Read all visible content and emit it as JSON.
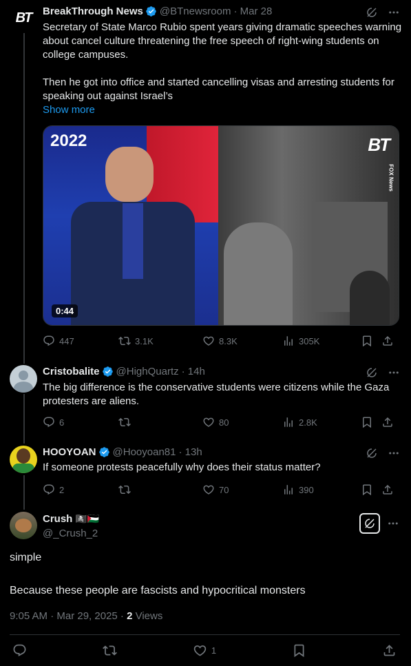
{
  "posts": [
    {
      "name": "BreakThrough News",
      "handle": "@BTnewsroom",
      "time": "· Mar 28",
      "text1": "Secretary of State Marco Rubio spent years giving dramatic speeches warning about cancel culture threatening the free speech of right-wing students on college campuses.",
      "text2": "Then he got into office and started cancelling visas and arresting students for speaking out against Israel’s",
      "show_more": "Show more",
      "media": {
        "year": "2022",
        "duration": "0:44",
        "logo": "BT",
        "watermark": "FOX News"
      },
      "replies": "447",
      "reposts": "3.1K",
      "likes": "8.3K",
      "views": "305K"
    },
    {
      "name": "Cristobalite",
      "handle": "@HighQuartz",
      "time": "· 14h",
      "text": "The big difference is the conservative students were citizens while the Gaza protesters are aliens.",
      "replies": "6",
      "reposts": "",
      "likes": "80",
      "views": "2.8K"
    },
    {
      "name": "HOOYOAN",
      "handle": "@Hooyoan81",
      "time": "· 13h",
      "text": "If someone protests peacefully why does their status matter?",
      "replies": "2",
      "reposts": "",
      "likes": "70",
      "views": "390"
    }
  ],
  "main": {
    "name": "Crush",
    "emoji": "🏴‍☠️🇵🇸",
    "handle": "@_Crush_2",
    "line1": "simple",
    "line2": "Because these  people are fascists and hypocritical monsters",
    "time": "9:05 AM · Mar 29, 2025 · ",
    "views_count": "2",
    "views_label": " Views",
    "likes": "1"
  },
  "colors": {
    "accent": "#1d9bf0",
    "muted": "#71767b",
    "text": "#e7e9ea",
    "bg": "#000000"
  },
  "icons": [
    "reply-icon",
    "repost-icon",
    "like-icon",
    "views-icon",
    "bookmark-icon",
    "share-icon",
    "grok-icon",
    "more-icon",
    "verified-icon"
  ]
}
